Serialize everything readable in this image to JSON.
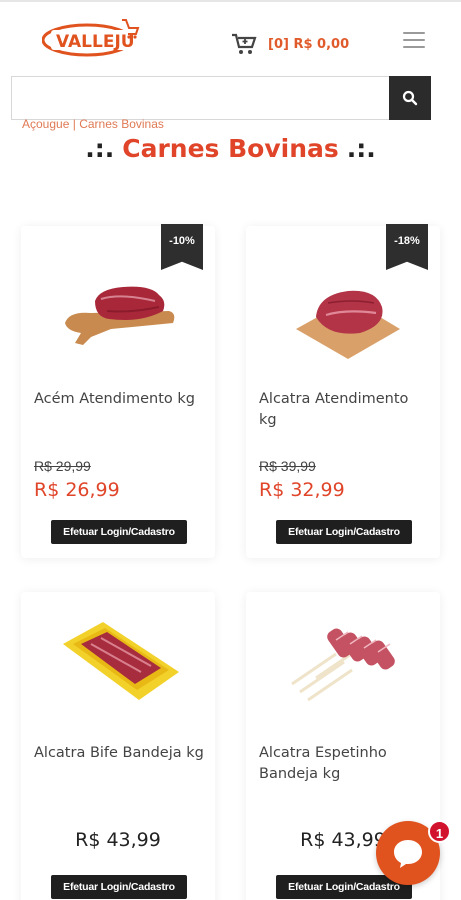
{
  "header": {
    "logo_text": "VALLEJU",
    "cart_text": "[0] R$ 0,00",
    "search_placeholder": ""
  },
  "breadcrumb": {
    "part1": "Açougue",
    "separator": "|",
    "part2": "Carnes Bovinas"
  },
  "page": {
    "title_left": ".:.",
    "title": "Carnes Bovinas",
    "title_right": ".:."
  },
  "products": [
    {
      "name": "Acém Atendimento kg",
      "discount": "-10%",
      "old_price": "R$ 29,99",
      "price": "R$ 26,99",
      "button": "Efetuar Login/Cadastro"
    },
    {
      "name": "Alcatra Atendimento kg",
      "discount": "-18%",
      "old_price": "R$ 39,99",
      "price": "R$ 32,99",
      "button": "Efetuar Login/Cadastro"
    },
    {
      "name": "Alcatra Bife Bandeja kg",
      "price": "R$ 43,99",
      "button": "Efetuar Login/Cadastro"
    },
    {
      "name": "Alcatra Espetinho Bandeja kg",
      "price": "R$ 43,99",
      "button": "Efetuar Login/Cadastro"
    }
  ],
  "chat": {
    "badge_count": "1"
  },
  "colors": {
    "accent": "#e0452a",
    "dark": "#1f1f1f",
    "chat": "#e0521e",
    "badge": "#d2132e"
  },
  "icons": [
    "cart-icon",
    "hamburger-menu-icon",
    "search-icon",
    "chat-icon"
  ]
}
